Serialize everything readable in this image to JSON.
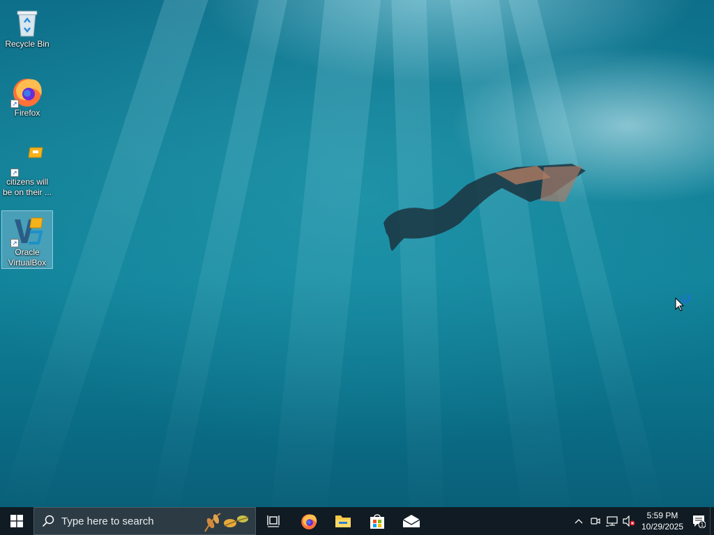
{
  "desktop": {
    "icons": [
      {
        "label": "Recycle Bin"
      },
      {
        "label": "Firefox"
      },
      {
        "label": "citizens will be on their ..."
      },
      {
        "label": "Oracle VirtualBox"
      }
    ]
  },
  "taskbar": {
    "search_placeholder": "Type here to search",
    "apps": [
      "task-view",
      "firefox",
      "file-explorer",
      "microsoft-store",
      "mail"
    ],
    "clock": {
      "time": "5:59 PM",
      "date": "10/29/2025"
    },
    "notification_count": "1"
  },
  "colors": {
    "taskbar": "#101b23",
    "search_box": "#2d3b44",
    "accent": "#0078d7"
  }
}
